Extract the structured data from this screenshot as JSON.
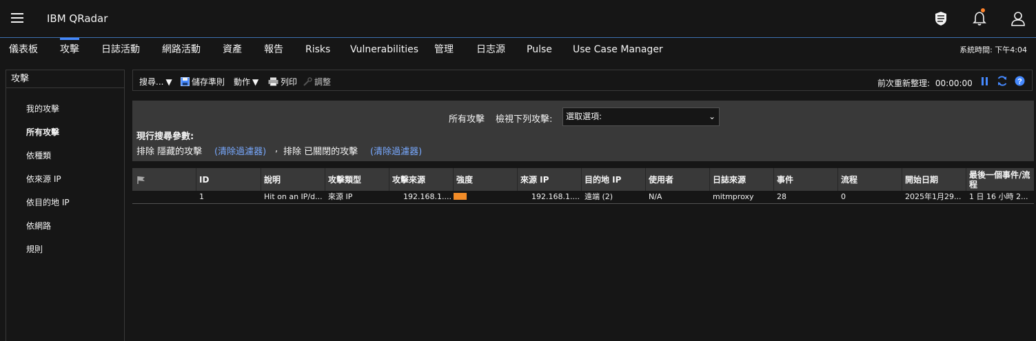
{
  "app": {
    "title": "IBM QRadar"
  },
  "nav": {
    "items": [
      "儀表板",
      "攻擊",
      "日誌活動",
      "網路活動",
      "資產",
      "報告",
      "Risks",
      "Vulnerabilities",
      "管理",
      "日志源",
      "Pulse",
      "Use Case Manager"
    ],
    "active": "攻擊",
    "system_time_label": "系統時間:",
    "system_time": "下午4:04"
  },
  "sidebar": {
    "title": "攻擊",
    "items": [
      "我的攻擊",
      "所有攻擊",
      "依種類",
      "依來源 IP",
      "依目的地 IP",
      "依網路",
      "規則"
    ],
    "selected": "所有攻擊"
  },
  "toolbar": {
    "search": "搜尋...",
    "save_criteria": "儲存準則",
    "actions": "動作",
    "print": "列印",
    "tune": "調整",
    "refresh_label": "前次重新整理:",
    "refresh_time": "00:00:00"
  },
  "filter": {
    "all_offenses": "所有攻擊",
    "view_label": "檢視下列攻擊:",
    "select_value": "選取選項:",
    "current_params_label": "現行搜尋參數:",
    "exclude1": "排除 隱藏的攻擊",
    "clear1": "(清除過濾器)",
    "separator": ",",
    "exclude2": "排除 已關閉的攻擊",
    "clear2": "(清除過濾器)"
  },
  "table": {
    "headers": [
      "ID",
      "說明",
      "攻擊類型",
      "攻擊來源",
      "強度",
      "來源 IP",
      "目的地 IP",
      "使用者",
      "日誌來源",
      "事件",
      "流程",
      "開始日期",
      "最後一個事件/流程"
    ],
    "rows": [
      {
        "id": "1",
        "description": "Hit on an IP/d...",
        "offense_type": "來源 IP",
        "offense_source": "192.168.1....",
        "magnitude": 0.3,
        "source_ip": "192.168.1....",
        "dest_ip": "遠端 (2)",
        "user": "N/A",
        "log_source": "mitmproxy",
        "events": "28",
        "flows": "0",
        "start_date": "2025年1月29...",
        "last_event": "1 日 16 小時 2..."
      }
    ]
  },
  "colors": {
    "accent": "#4589ff",
    "magnitude": "#f28c28",
    "link": "#78a9ff",
    "notification": "#ff832b"
  }
}
